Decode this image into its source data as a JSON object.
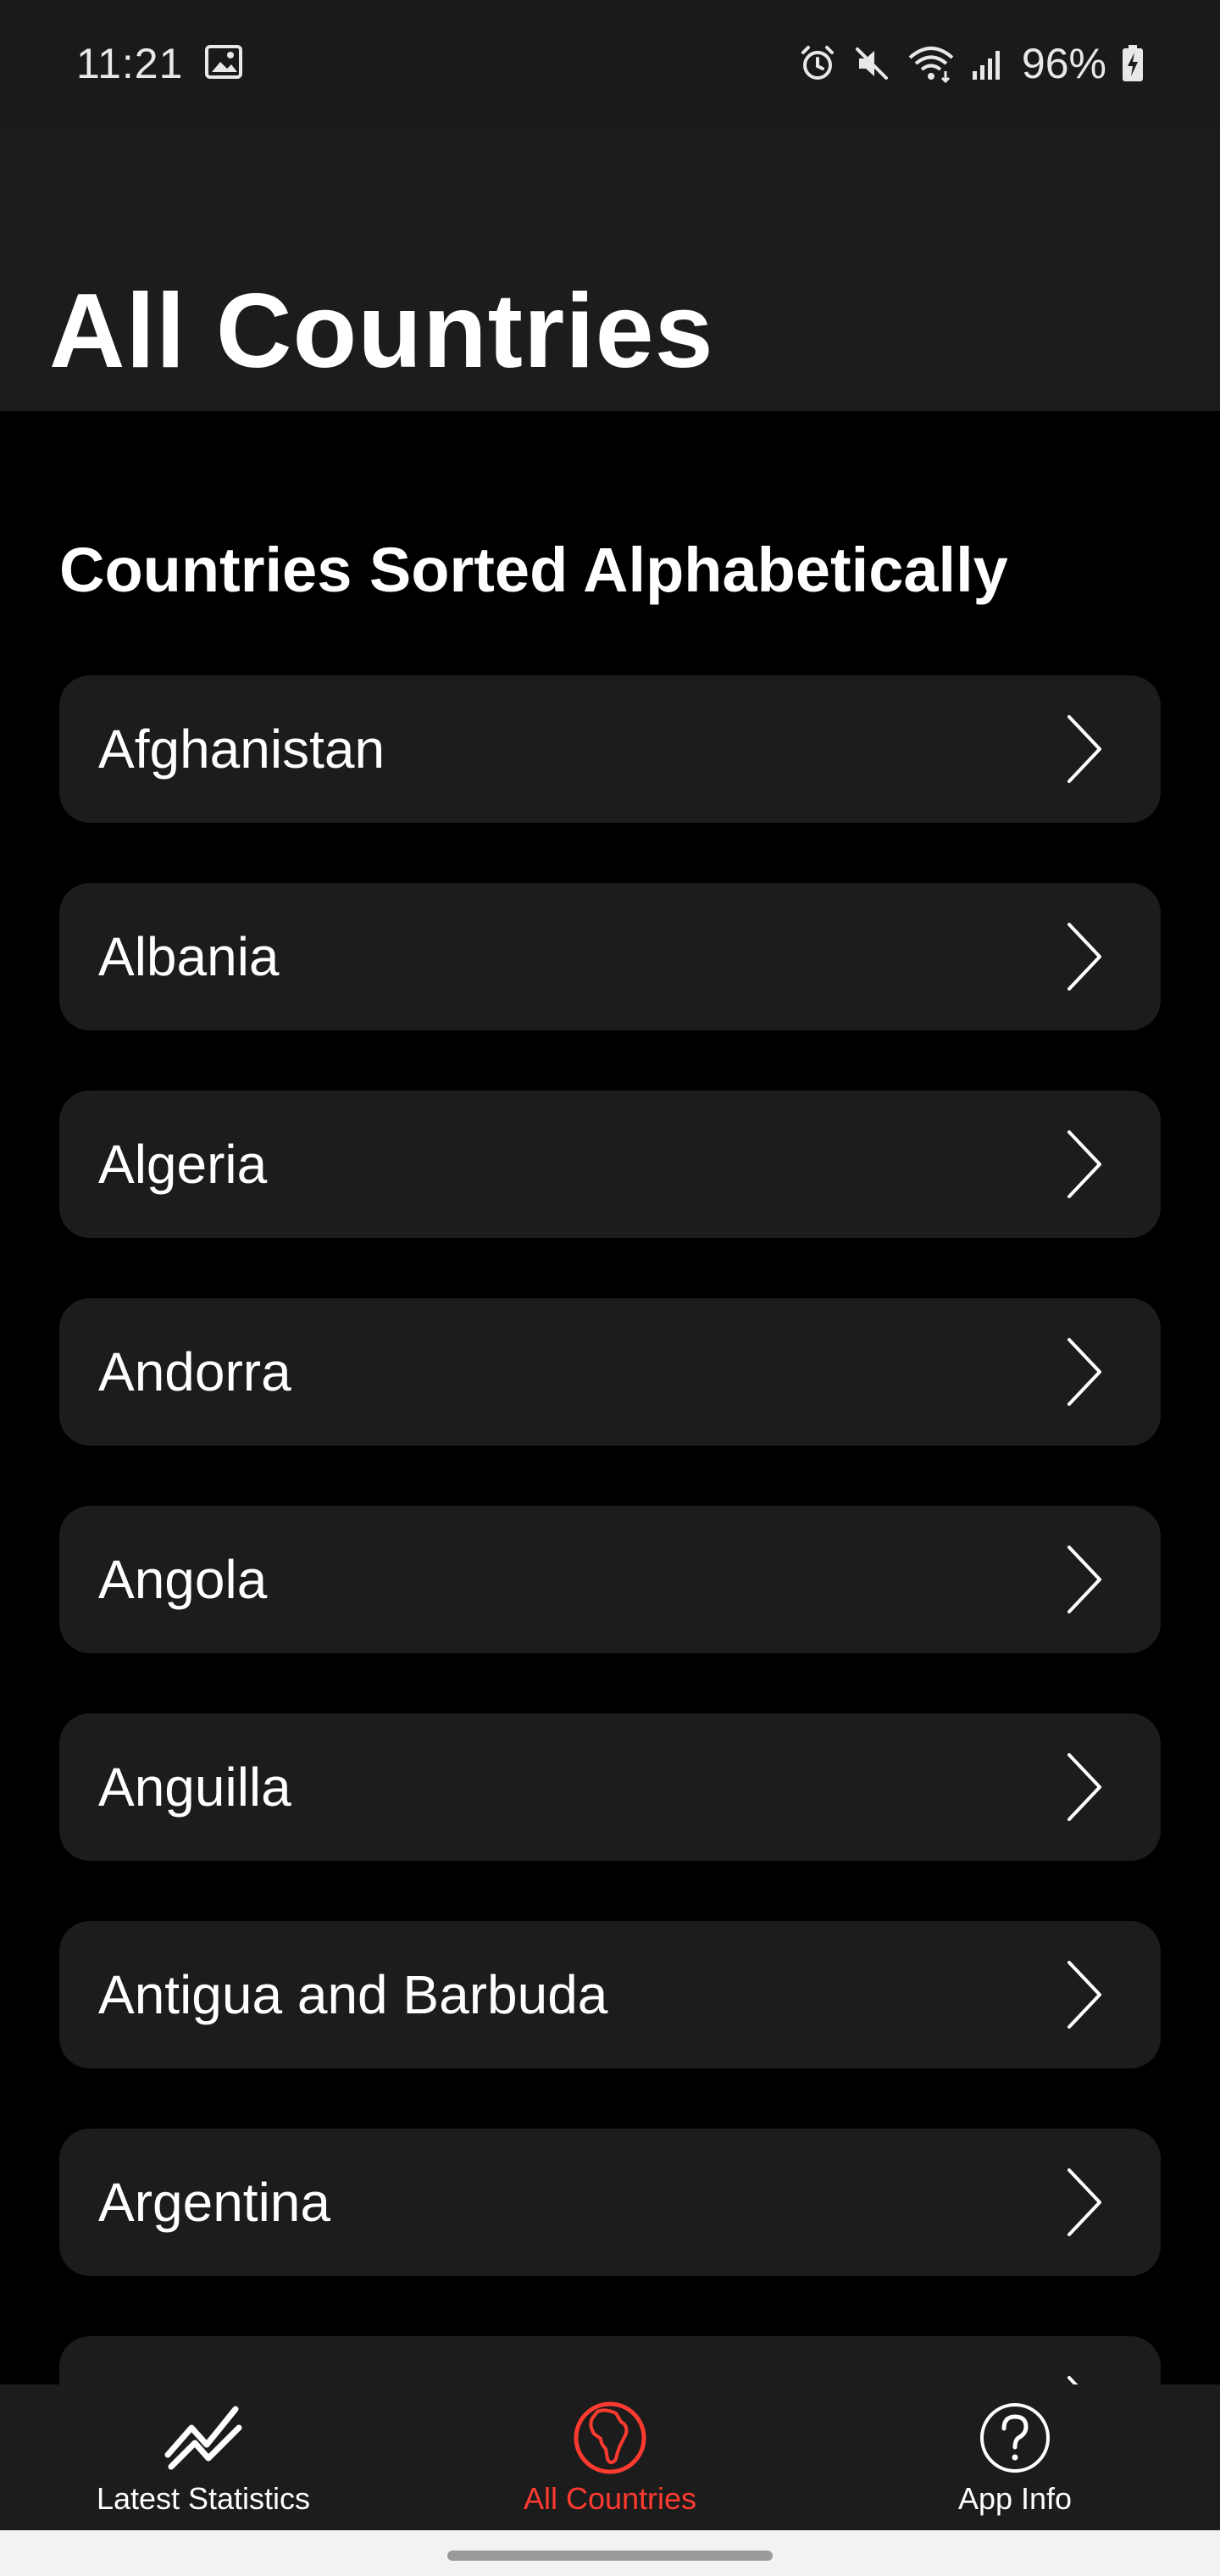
{
  "status_bar": {
    "time": "11:21",
    "battery": "96%",
    "icons": [
      "image-icon",
      "alarm-icon",
      "mute-icon",
      "wifi-icon",
      "signal-icon",
      "battery-charging-icon"
    ]
  },
  "header": {
    "title": "All Countries"
  },
  "section": {
    "title": "Countries Sorted Alphabetically"
  },
  "countries": [
    "Afghanistan",
    "Albania",
    "Algeria",
    "Andorra",
    "Angola",
    "Anguilla",
    "Antigua and Barbuda",
    "Argentina"
  ],
  "bottom_nav": {
    "items": [
      {
        "label": "Latest Statistics",
        "icon": "trend-chart-icon",
        "active": false
      },
      {
        "label": "All Countries",
        "icon": "africa-globe-icon",
        "active": true
      },
      {
        "label": "App Info",
        "icon": "question-circle-icon",
        "active": false
      }
    ]
  },
  "colors": {
    "background": "#000000",
    "surface": "#1c1c1c",
    "accent": "#ff3b30",
    "text": "#ffffff"
  }
}
